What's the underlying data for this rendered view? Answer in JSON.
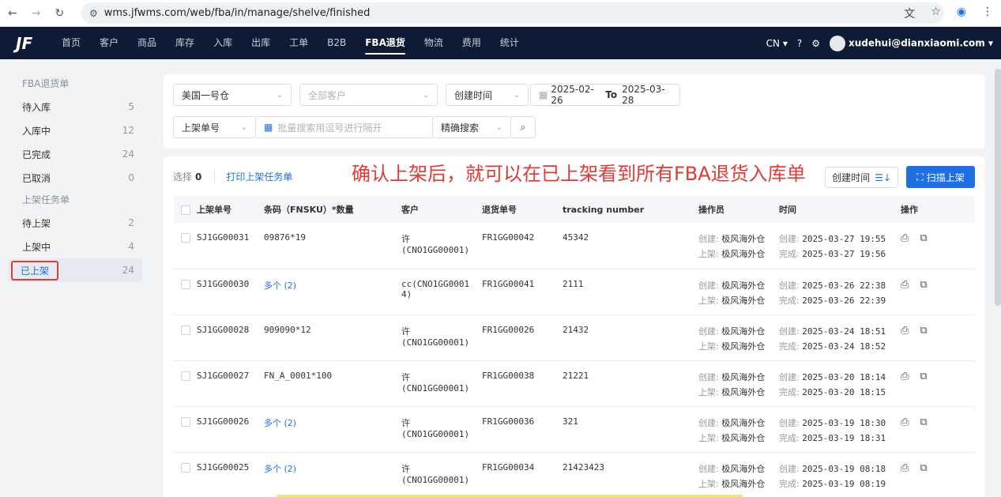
{
  "browser": {
    "url": "wms.jfwms.com/web/fba/in/manage/shelve/finished"
  },
  "nav": {
    "items": [
      "首页",
      "客户",
      "商品",
      "库存",
      "入库",
      "出库",
      "工单",
      "B2B",
      "FBA退货",
      "物流",
      "费用",
      "统计"
    ],
    "active": "FBA退货",
    "lang": "CN",
    "user": "xudehui@dianxiaomi.com"
  },
  "sidebar": {
    "section1": "FBA退货单",
    "items1": [
      {
        "label": "待入库",
        "count": "5"
      },
      {
        "label": "入库中",
        "count": "12"
      },
      {
        "label": "已完成",
        "count": "24"
      },
      {
        "label": "已取消",
        "count": "0"
      }
    ],
    "section2": "上架任务单",
    "items2": [
      {
        "label": "待上架",
        "count": "2"
      },
      {
        "label": "上架中",
        "count": "4"
      },
      {
        "label": "已上架",
        "count": "24"
      }
    ]
  },
  "filters": {
    "warehouse": "美国一号仓",
    "customer_placeholder": "全部客户",
    "time_type": "创建时间",
    "date_from": "2025-02-26",
    "date_to_word": "To",
    "date_to": "2025-03-28",
    "order_type": "上架单号",
    "batch_placeholder": "批量搜索用逗号进行隔开",
    "search_mode": "精确搜索"
  },
  "toolbar": {
    "selected_label": "选择",
    "selected_count": "0",
    "print_label": "打印上架任务单",
    "overlay_text": "确认上架后，就可以在已上架看到所有FBA退货入库单",
    "sort_label": "创建时间",
    "scan_label": "扫描上架"
  },
  "table": {
    "headers": [
      "上架单号",
      "条码（FNSKU）*数量",
      "客户",
      "退货单号",
      "tracking number",
      "操作员",
      "时间",
      "操作"
    ],
    "op_labels": {
      "created": "创建:",
      "shelved": "上架:",
      "finished": "完成:"
    },
    "rows": [
      {
        "no": "SJ1GG00031",
        "barcode": "09876*19",
        "barcode_link": false,
        "customer": "许\n(CNO1GG00001)",
        "ret": "FR1GG00042",
        "tracking": "45342",
        "creator": "极风海外仓",
        "shelver": "极风海外仓",
        "t1": "2025-03-27 19:55",
        "t2": "2025-03-27 19:56"
      },
      {
        "no": "SJ1GG00030",
        "barcode": "多个 (2)",
        "barcode_link": true,
        "customer": "cc(CNO1GG0001\n4)",
        "ret": "FR1GG00041",
        "tracking": "2111",
        "creator": "极风海外仓",
        "shelver": "极风海外仓",
        "t1": "2025-03-26 22:38",
        "t2": "2025-03-26 22:39"
      },
      {
        "no": "SJ1GG00028",
        "barcode": "909090*12",
        "barcode_link": false,
        "customer": "许\n(CNO1GG00001)",
        "ret": "FR1GG00026",
        "tracking": "21432",
        "creator": "极风海外仓",
        "shelver": "极风海外仓",
        "t1": "2025-03-24 18:51",
        "t2": "2025-03-24 18:52"
      },
      {
        "no": "SJ1GG00027",
        "barcode": "FN_A_0001*100",
        "barcode_link": false,
        "customer": "许\n(CNO1GG00001)",
        "ret": "FR1GG00038",
        "tracking": "21221",
        "creator": "极风海外仓",
        "shelver": "极风海外仓",
        "t1": "2025-03-20 18:14",
        "t2": "2025-03-20 18:15"
      },
      {
        "no": "SJ1GG00026",
        "barcode": "多个 (2)",
        "barcode_link": true,
        "customer": "许\n(CNO1GG00001)",
        "ret": "FR1GG00036",
        "tracking": "321",
        "creator": "极风海外仓",
        "shelver": "极风海外仓",
        "t1": "2025-03-19 18:30",
        "t2": "2025-03-19 18:31"
      },
      {
        "no": "SJ1GG00025",
        "barcode": "多个 (2)",
        "barcode_link": true,
        "customer": "许\n(CNO1GG00001)",
        "ret": "FR1GG00034",
        "tracking": "21423423",
        "creator": "极风海外仓",
        "shelver": "极风海外仓",
        "t1": "2025-03-19 08:18",
        "t2": "2025-03-19 08:19"
      }
    ]
  }
}
